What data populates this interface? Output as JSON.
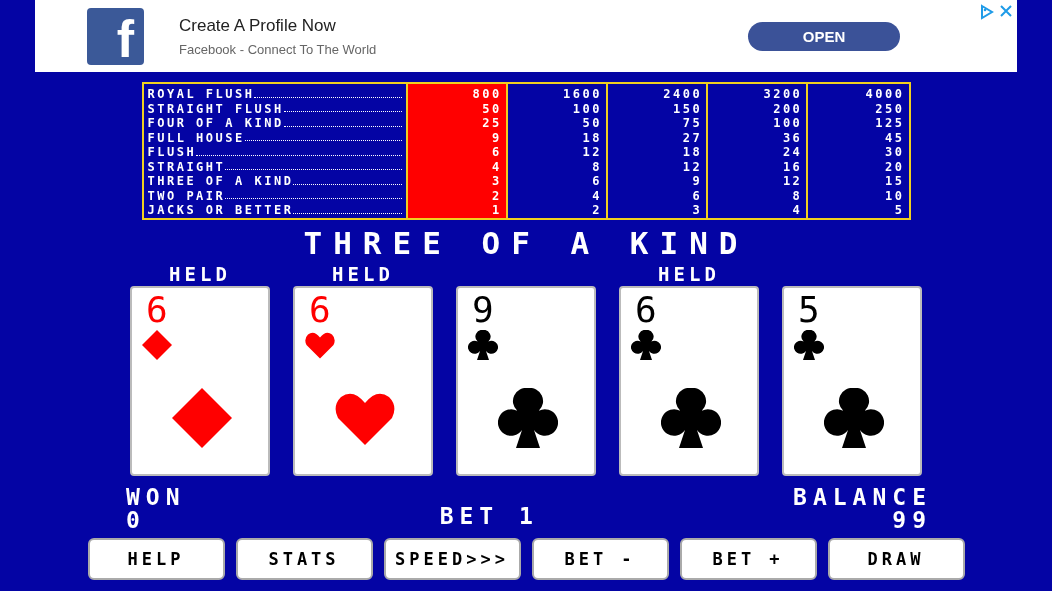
{
  "ad": {
    "logo_letter": "f",
    "title": "Create A Profile Now",
    "subtitle": "Facebook - Connect To The World",
    "button": "OPEN"
  },
  "paytable": {
    "columns": [
      {
        "selected": true
      },
      {
        "selected": false
      },
      {
        "selected": false
      },
      {
        "selected": false
      },
      {
        "selected": false
      }
    ],
    "rows": [
      {
        "hand": "ROYAL FLUSH",
        "payouts": [
          "800",
          "1600",
          "2400",
          "3200",
          "4000"
        ]
      },
      {
        "hand": "STRAIGHT FLUSH",
        "payouts": [
          "50",
          "100",
          "150",
          "200",
          "250"
        ]
      },
      {
        "hand": "FOUR OF A KIND",
        "payouts": [
          "25",
          "50",
          "75",
          "100",
          "125"
        ]
      },
      {
        "hand": "FULL HOUSE",
        "payouts": [
          "9",
          "18",
          "27",
          "36",
          "45"
        ]
      },
      {
        "hand": "FLUSH",
        "payouts": [
          "6",
          "12",
          "18",
          "24",
          "30"
        ]
      },
      {
        "hand": "STRAIGHT",
        "payouts": [
          "4",
          "8",
          "12",
          "16",
          "20"
        ]
      },
      {
        "hand": "THREE OF A KIND",
        "payouts": [
          "3",
          "6",
          "9",
          "12",
          "15"
        ]
      },
      {
        "hand": "TWO PAIR",
        "payouts": [
          "2",
          "4",
          "6",
          "8",
          "10"
        ]
      },
      {
        "hand": "JACKS OR BETTER",
        "payouts": [
          "1",
          "2",
          "3",
          "4",
          "5"
        ]
      }
    ]
  },
  "result": "THREE OF A KIND",
  "cards": [
    {
      "rank": "6",
      "kind": "diamond",
      "held_label": "HELD"
    },
    {
      "rank": "6",
      "kind": "heart",
      "held_label": "HELD"
    },
    {
      "rank": "9",
      "kind": "club"
    },
    {
      "rank": "6",
      "kind": "club",
      "held_label": "HELD"
    },
    {
      "rank": "5",
      "kind": "club"
    }
  ],
  "won": {
    "label": "WON",
    "value": "0"
  },
  "bet": "BET 1",
  "balance": {
    "label": "BALANCE",
    "value": "99"
  },
  "buttons": [
    "HELP",
    "STATS",
    "SPEED>>>",
    "BET -",
    "BET +",
    "DRAW"
  ]
}
